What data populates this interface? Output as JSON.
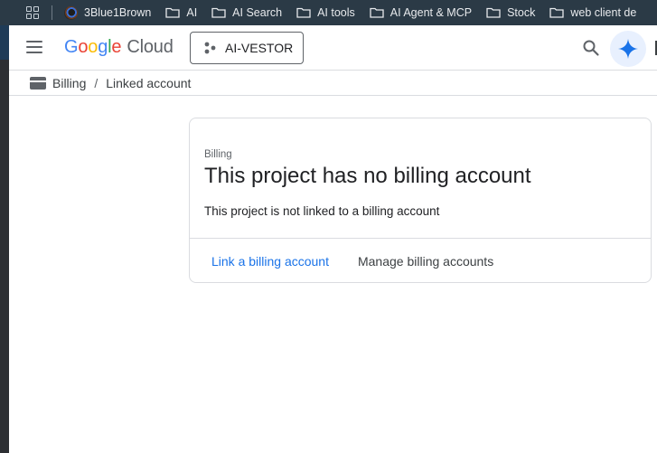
{
  "bookmarks_bar": {
    "items": [
      {
        "label": "3Blue1Brown",
        "icon": "site-favicon"
      },
      {
        "label": "AI",
        "icon": "folder-icon"
      },
      {
        "label": "AI Search",
        "icon": "folder-icon"
      },
      {
        "label": "AI tools",
        "icon": "folder-icon"
      },
      {
        "label": "AI Agent & MCP",
        "icon": "folder-icon"
      },
      {
        "label": "Stock",
        "icon": "folder-icon"
      },
      {
        "label": "web client de",
        "icon": "folder-icon"
      }
    ]
  },
  "header": {
    "logo_google": "Google",
    "logo_cloud": "Cloud",
    "project_name": "AI-VESTOR"
  },
  "breadcrumb": {
    "root": "Billing",
    "separator": "/",
    "current": "Linked account"
  },
  "card": {
    "overline": "Billing",
    "title": "This project has no billing account",
    "description": "This project is not linked to a billing account",
    "primary_action": "Link a billing account",
    "secondary_action": "Manage billing accounts"
  },
  "colors": {
    "bookmarks_bg": "#2b3a46",
    "link_blue": "#1a73e8",
    "gemini_bg": "#e8f0fe",
    "divider": "#dadce0"
  }
}
